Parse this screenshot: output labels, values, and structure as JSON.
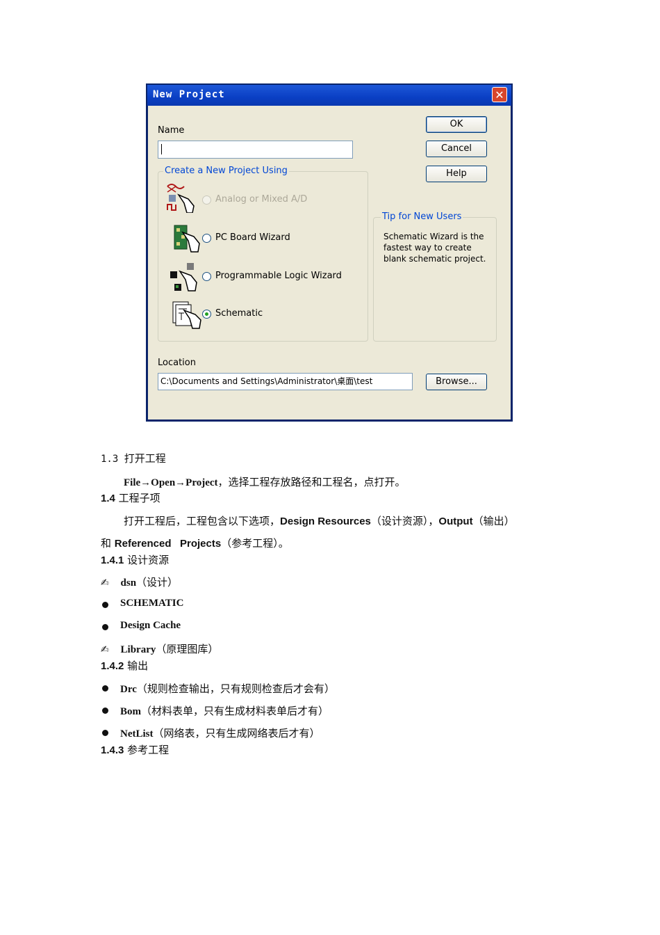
{
  "dialog": {
    "title": "New Project",
    "close_glyph": "✕",
    "name_label": "Name",
    "name_value": "",
    "buttons": {
      "ok": "OK",
      "cancel": "Cancel",
      "help": "Help",
      "browse": "Browse..."
    },
    "create_group_label": "Create a New Project Using",
    "options": [
      {
        "label": "Analog or Mixed A/D",
        "icon": "analog-wizard-icon",
        "disabled": true,
        "selected": false
      },
      {
        "label": "PC Board Wizard",
        "icon": "pcb-wizard-icon",
        "disabled": false,
        "selected": false
      },
      {
        "label": "Programmable Logic Wizard",
        "icon": "pld-wizard-icon",
        "disabled": false,
        "selected": false
      },
      {
        "label": "Schematic",
        "icon": "schematic-icon",
        "disabled": false,
        "selected": true
      }
    ],
    "tip_label": "Tip for New Users",
    "tip_text": "Schematic Wizard is the fastest way to create blank schematic project.",
    "location_label": "Location",
    "location_value": "C:\\Documents and Settings\\Administrator\\桌面\\test"
  },
  "doc": {
    "s13_num": "1.3",
    "s13_title": "打开工程",
    "s13_path": "File→Open→Project",
    "s13_text": "，选择工程存放路径和工程名，点打开。",
    "s14_num": "1.4",
    "s14_title": "工程子项",
    "s14_p1_a": "打开工程后，工程包含以下选项，",
    "s14_p1_b": "Design Resources",
    "s14_p1_c": "（设计资源），",
    "s14_p1_d": "Output",
    "s14_p1_e": "（输出）",
    "s14_p2_a": "和 ",
    "s14_p2_b": "Referenced   Projects",
    "s14_p2_c": "（参考工程）。",
    "s141_num": "1.4.1",
    "s141_title": "设计资源",
    "dsn_name": "dsn",
    "dsn_desc": "（设计）",
    "item_schematic": "SCHEMATIC",
    "item_cache": "Design Cache",
    "lib_name": "Library",
    "lib_desc": "（原理图库）",
    "s142_num": "1.4.2",
    "s142_title": "输出",
    "drc_name": "Drc",
    "drc_desc": "（规则检查输出，只有规则检查后才会有）",
    "bom_name": "Bom",
    "bom_desc": "（材料表单，只有生成材料表单后才有）",
    "netlist_name": "NetList",
    "netlist_desc": "（网络表，只有生成网络表后才有）",
    "s143_num": "1.4.3",
    "s143_title": "参考工程"
  },
  "icons": {
    "pen": "✍",
    "bullet": "●"
  }
}
